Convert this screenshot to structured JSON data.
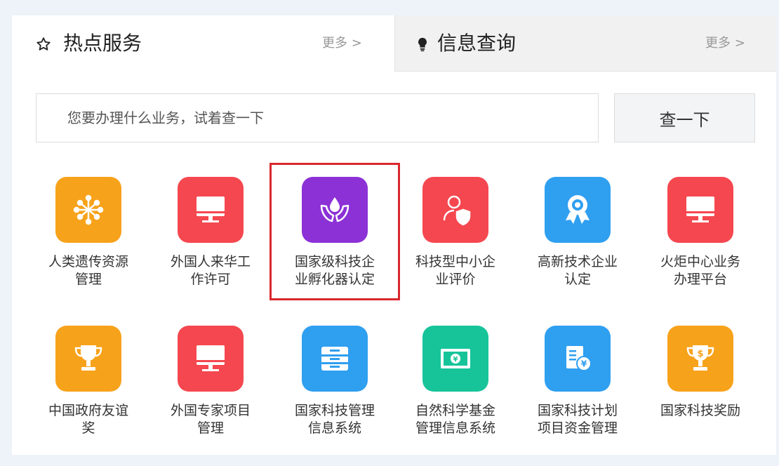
{
  "tabs": [
    {
      "title": "热点服务",
      "more": "更多 >",
      "icon": "star-outline-icon"
    },
    {
      "title": "信息查询",
      "more": "更多 >",
      "icon": "lightbulb-icon"
    }
  ],
  "search": {
    "placeholder": "您要办理什么业务，试着查一下",
    "button": "查一下"
  },
  "services": [
    {
      "label": "人类遗传资源管理",
      "line1": "人类遗传资源",
      "line2": "管理",
      "color": "#f7a21b",
      "icon": "molecule-icon"
    },
    {
      "label": "外国人来华工作许可",
      "line1": "外国人来华工",
      "line2": "作许可",
      "color": "#f5474f",
      "icon": "monitor-icon"
    },
    {
      "label": "国家级科技企业孵化器认定",
      "line1": "国家级科技企",
      "line2": "业孵化器认定",
      "color": "#8c31d6",
      "icon": "hands-seedling-icon"
    },
    {
      "label": "科技型中小企业评价",
      "line1": "科技型中小企",
      "line2": "业评价",
      "color": "#f5474f",
      "icon": "person-shield-icon"
    },
    {
      "label": "高新技术企业认定",
      "line1": "高新技术企业",
      "line2": "认定",
      "color": "#2f9ff0",
      "icon": "award-badge-icon"
    },
    {
      "label": "火炬中心业务办理平台",
      "line1": "火炬中心业务",
      "line2": "办理平台",
      "color": "#f5474f",
      "icon": "monitor-icon"
    },
    {
      "label": "中国政府友谊奖",
      "line1": "中国政府友谊",
      "line2": "奖",
      "color": "#f7a21b",
      "icon": "trophy-icon"
    },
    {
      "label": "外国专家项目管理",
      "line1": "外国专家项目",
      "line2": "管理",
      "color": "#f5474f",
      "icon": "monitor-icon"
    },
    {
      "label": "国家科技管理信息系统",
      "line1": "国家科技管理",
      "line2": "信息系统",
      "color": "#2f9ff0",
      "icon": "file-cabinet-icon"
    },
    {
      "label": "自然科学基金管理信息系统",
      "line1": "自然科学基金",
      "line2": "管理信息系统",
      "color": "#17c49a",
      "icon": "banknote-icon"
    },
    {
      "label": "国家科技计划项目资金管理",
      "line1": "国家科技计划",
      "line2": "项目资金管理",
      "color": "#2f9ff0",
      "icon": "document-yen-icon"
    },
    {
      "label": "国家科技奖励",
      "line1": "国家科技奖励",
      "line2": "",
      "color": "#f7a21b",
      "icon": "trophy-dollar-icon"
    }
  ]
}
